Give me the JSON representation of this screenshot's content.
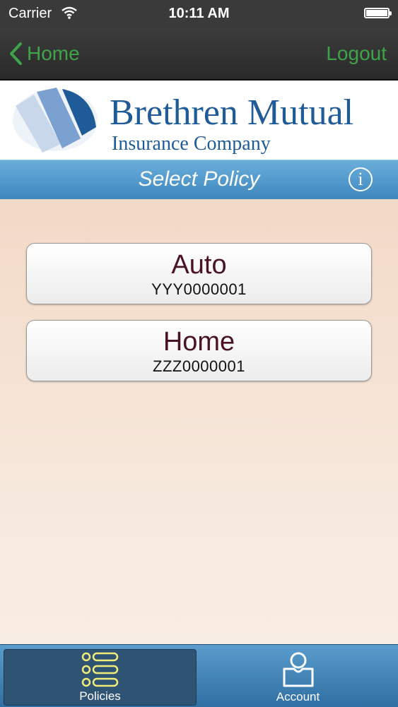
{
  "status": {
    "carrier": "Carrier",
    "time": "10:11 AM"
  },
  "nav": {
    "back_label": "Home",
    "logout_label": "Logout"
  },
  "brand": {
    "name": "Brethren Mutual",
    "subtitle": "Insurance Company"
  },
  "title_bar": {
    "title": "Select Policy",
    "info_icon": "i"
  },
  "policies": [
    {
      "type": "Auto",
      "number": "YYY0000001"
    },
    {
      "type": "Home",
      "number": "ZZZ0000001"
    }
  ],
  "tabs": [
    {
      "label": "Policies",
      "icon": "list-icon",
      "active": true
    },
    {
      "label": "Account",
      "icon": "account-icon",
      "active": false
    }
  ],
  "colors": {
    "accent": "#3fa34a",
    "brand": "#1f5c97",
    "title_bar": "#4a93c8",
    "policy_text": "#4a1226"
  }
}
